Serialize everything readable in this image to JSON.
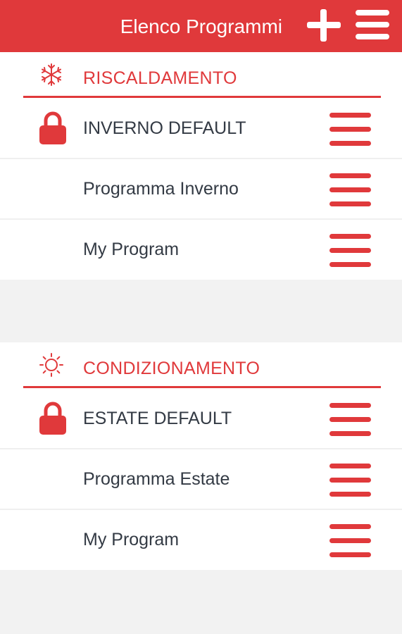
{
  "header": {
    "title": "Elenco Programmi",
    "add_icon": "plus-icon",
    "menu_icon": "hamburger-menu-icon",
    "background_color": "#e0393b"
  },
  "sections": [
    {
      "title": "RISCALDAMENTO",
      "icon": "snowflake-icon",
      "programs": [
        {
          "label": "INVERNO DEFAULT",
          "locked": true
        },
        {
          "label": "Programma Inverno",
          "locked": false
        },
        {
          "label": "My Program",
          "locked": false
        }
      ]
    },
    {
      "title": "CONDIZIONAMENTO",
      "icon": "sun-icon",
      "programs": [
        {
          "label": "ESTATE DEFAULT",
          "locked": true
        },
        {
          "label": "Programma Estate",
          "locked": false
        },
        {
          "label": "My Program",
          "locked": false
        }
      ]
    }
  ],
  "colors": {
    "accent": "#e0393b",
    "text": "#333a44",
    "background": "#f2f2f2"
  }
}
